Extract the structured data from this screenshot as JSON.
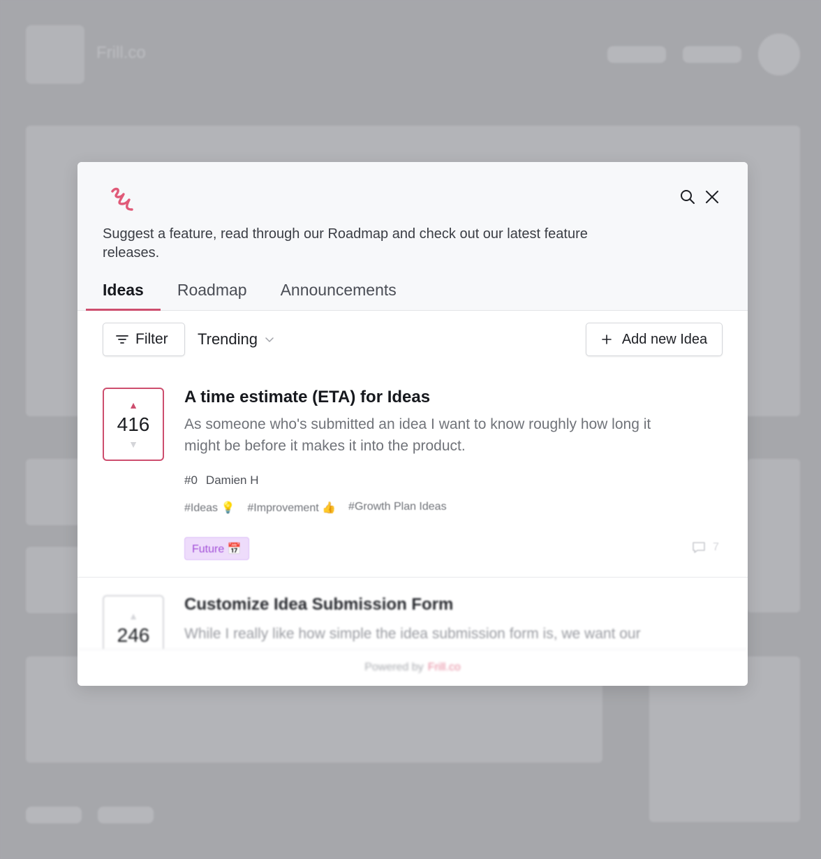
{
  "background": {
    "brand": "Frill.co"
  },
  "modal": {
    "intro": "Suggest a feature, read through our Roadmap and check out our latest feature releases.",
    "tabs": [
      {
        "label": "Ideas",
        "active": true
      },
      {
        "label": "Roadmap",
        "active": false
      },
      {
        "label": "Announcements",
        "active": false
      }
    ],
    "toolbar": {
      "filter_label": "Filter",
      "sort_label": "Trending",
      "add_label": "Add new Idea"
    },
    "ideas": [
      {
        "votes": "416",
        "title": "A time estimate (ETA) for Ideas",
        "description": "As someone who's submitted an idea I want to know roughly how long it might be before it makes it into the product.",
        "number": "#0",
        "author": "Damien H",
        "tags": [
          "#Ideas 💡",
          "#Improvement 👍",
          "#Growth Plan Ideas"
        ],
        "status": "Future 📅",
        "comments": "7"
      },
      {
        "votes": "246",
        "title": "Customize Idea Submission Form",
        "description": "While I really like how simple the idea submission form is, we want our"
      }
    ],
    "footer": {
      "powered_by": "Powered by",
      "brand": "Frill.co"
    }
  },
  "colors": {
    "accent": "#cd4e6e",
    "status_future": "#a351d8"
  }
}
